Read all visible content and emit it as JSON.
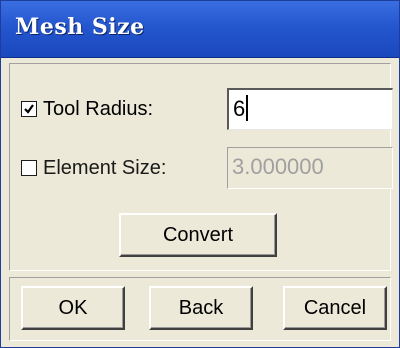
{
  "window": {
    "title": "Mesh Size"
  },
  "tool_radius": {
    "checked": true,
    "label": "Tool Radius:",
    "value": "6"
  },
  "element_size": {
    "checked": false,
    "label": "Element Size:",
    "value": "3.000000",
    "enabled": false
  },
  "buttons": {
    "convert": "Convert",
    "ok": "OK",
    "back": "Back",
    "cancel": "Cancel"
  },
  "colors": {
    "title_bar": "#2456cf",
    "dialog_bg": "#ece9d8",
    "disabled_text": "#a0a0a0"
  }
}
